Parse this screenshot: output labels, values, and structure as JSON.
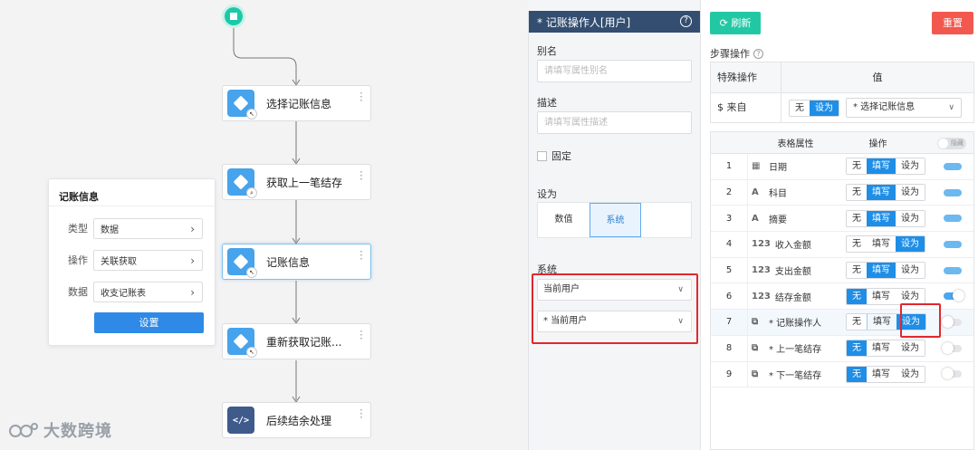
{
  "canvas": {
    "nodes": [
      {
        "label": "选择记账信息",
        "badge": "↖"
      },
      {
        "label": "获取上一笔结存",
        "badge": "⌕"
      },
      {
        "label": "记账信息",
        "badge": "↖"
      },
      {
        "label": "重新获取记账...",
        "badge": "↖"
      },
      {
        "label": "后续结余处理",
        "icon_text": "</>"
      }
    ],
    "info_card": {
      "title": "记账信息",
      "rows": [
        {
          "label": "类型",
          "value": "数据"
        },
        {
          "label": "操作",
          "value": "关联获取"
        },
        {
          "label": "数据",
          "value": "收支记账表"
        }
      ],
      "button": "设置"
    },
    "watermark": "大数跨境"
  },
  "props": {
    "title": "* 记账操作人[用户]",
    "help": "?",
    "alias_label": "别名",
    "alias_placeholder": "请填写属性别名",
    "desc_label": "描述",
    "desc_placeholder": "请填写属性描述",
    "fixed_label": "固定",
    "setas_label": "设为",
    "setas_options": [
      "数值",
      "系统"
    ],
    "setas_selected": "系统",
    "system_label": "系统",
    "system_value_1": "当前用户",
    "system_value_2": "* 当前用户"
  },
  "ops": {
    "refresh": "刷新",
    "reset": "重置",
    "step_ops": "步骤操作",
    "special": {
      "col1": "特殊操作",
      "col2": "值",
      "row_label": "$ 来自",
      "opts": [
        "无",
        "设为"
      ],
      "selected": "设为",
      "select_value": "* 选择记账信息"
    },
    "table": {
      "col_attr": "表格属性",
      "col_op": "操作",
      "header_toggle": "隐藏",
      "ops": [
        "无",
        "填写",
        "设为"
      ],
      "rows": [
        {
          "num": "1",
          "icon": "▦",
          "name": "日期",
          "op": "填写",
          "toggle": "half"
        },
        {
          "num": "2",
          "icon": "A",
          "name": "科目",
          "op": "填写",
          "toggle": "half"
        },
        {
          "num": "3",
          "icon": "A",
          "name": "摘要",
          "op": "填写",
          "toggle": "half"
        },
        {
          "num": "4",
          "icon": "123",
          "name": "收入金额",
          "op": "设为",
          "toggle": "half"
        },
        {
          "num": "5",
          "icon": "123",
          "name": "支出金额",
          "op": "填写",
          "toggle": "half"
        },
        {
          "num": "6",
          "icon": "123",
          "name": "结存金额",
          "op": "无",
          "toggle": "on"
        },
        {
          "num": "7",
          "icon": "⧉",
          "name": "* 记账操作人",
          "op": "设为",
          "toggle": "off"
        },
        {
          "num": "8",
          "icon": "⧉",
          "name": "* 上一笔结存",
          "op": "无",
          "toggle": "off"
        },
        {
          "num": "9",
          "icon": "⧉",
          "name": "* 下一笔结存",
          "op": "无",
          "toggle": "off"
        }
      ]
    }
  },
  "colors": {
    "accent": "#1f8ee6",
    "teal": "#22c8a4",
    "danger": "#f2584e",
    "highlight": "#e0282e",
    "panel_header": "#334e70"
  }
}
